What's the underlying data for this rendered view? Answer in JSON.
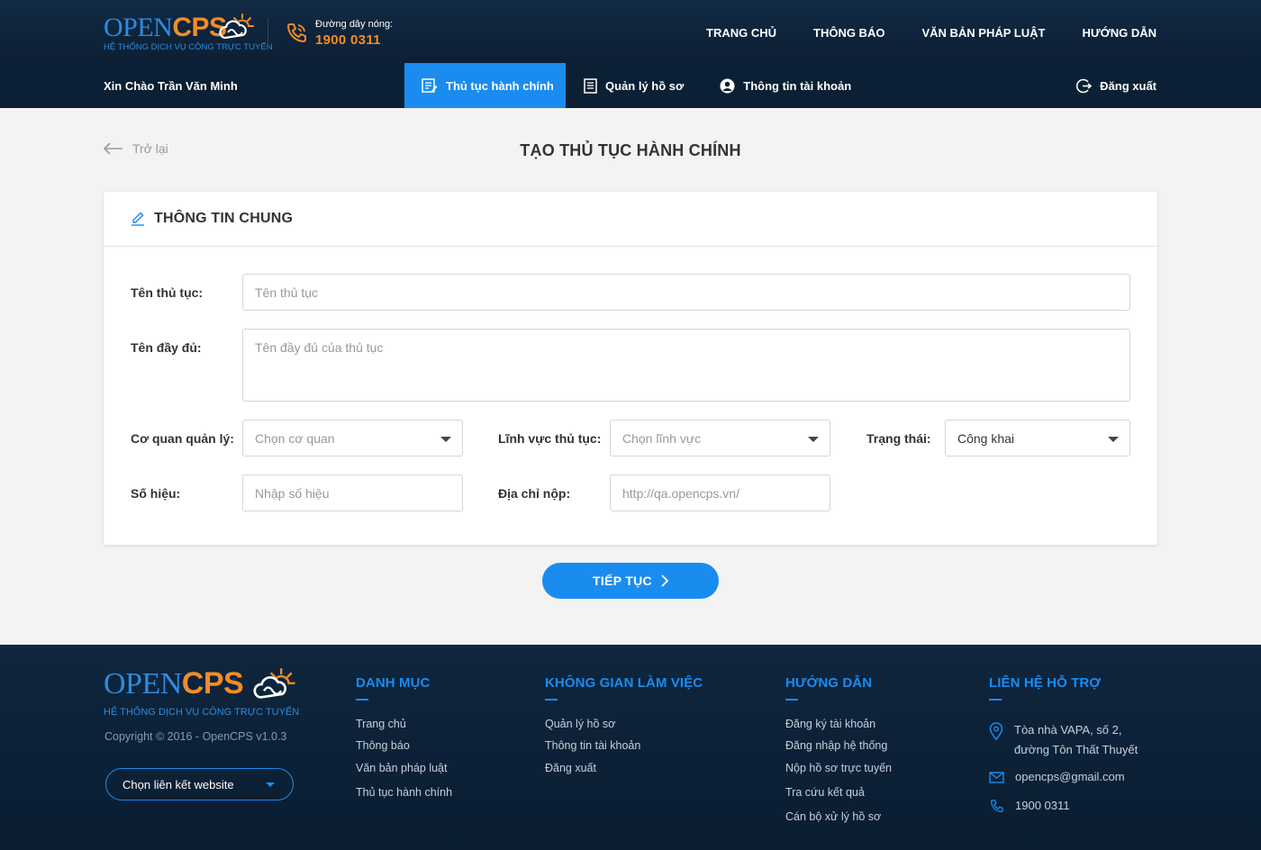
{
  "brand": {
    "logo_open": "OPEN",
    "logo_cps": "CPS",
    "tagline": "HỆ THỐNG DỊCH VỤ CÔNG TRỰC TUYẾN",
    "accent": "#1a8cf0",
    "orange": "#f28c28"
  },
  "header": {
    "hotline_label": "Đường dây nóng:",
    "hotline_number": "1900 0311",
    "nav": [
      "TRANG CHỦ",
      "THÔNG BÁO",
      "VĂN BẢN PHÁP LUẬT",
      "HƯỚNG DẪN"
    ]
  },
  "subnav": {
    "greeting": "Xin Chào Trần Văn Minh",
    "tabs": [
      {
        "label": "Thủ tục hành chính",
        "icon": "document-edit-icon",
        "active": true
      },
      {
        "label": "Quản lý hồ sơ",
        "icon": "document-list-icon",
        "active": false
      },
      {
        "label": "Thông tin tài khoản",
        "icon": "user-circle-icon",
        "active": false
      }
    ],
    "logout": "Đăng xuất"
  },
  "page": {
    "back": "Trở lại",
    "title": "TẠO THỦ TỤC HÀNH CHÍNH"
  },
  "form": {
    "section_title": "THÔNG TIN CHUNG",
    "name_label": "Tên thủ tục:",
    "name_placeholder": "Tên thủ tục",
    "fullname_label": "Tên đầy đủ:",
    "fullname_placeholder": "Tên đầy đủ của thủ tục",
    "agency_label": "Cơ quan quản lý:",
    "agency_value": "Chọn cơ quan",
    "field_label": "Lĩnh vực thủ tục:",
    "field_value": "Chọn lĩnh vực",
    "status_label": "Trạng thái:",
    "status_value": "Công khai",
    "code_label": "Số hiệu:",
    "code_placeholder": "Nhập số hiệu",
    "address_label": "Địa chỉ nộp:",
    "address_placeholder": "http://qa.opencps.vn/",
    "continue": "TIẾP TỤC"
  },
  "footer": {
    "copyright": "Copyright © 2016 - OpenCPS v1.0.3",
    "site_select": "Chọn liên kết website",
    "columns": [
      {
        "title": "DANH MỤC",
        "links": [
          "Trang chủ",
          "Thông báo",
          "Văn bản pháp luật",
          "Thủ tục hành chính"
        ]
      },
      {
        "title": "KHÔNG GIAN LÀM VIỆC",
        "links": [
          "Quản lý hồ sơ",
          "Thông tin tài khoản",
          "Đăng xuất"
        ]
      },
      {
        "title": "HƯỚNG DẪN",
        "links": [
          "Đăng ký tài khoản",
          "Đăng nhập hệ thống",
          "Nộp hồ sơ trực tuyến",
          "Tra cứu kết quả",
          "Cán bộ xử lý hồ sơ"
        ]
      }
    ],
    "contact": {
      "title": "LIÊN HỆ HỖ TRỢ",
      "address_line1": "Tòa nhà VAPA, số 2,",
      "address_line2": "đường Tôn Thất Thuyết",
      "email": "opencps@gmail.com",
      "phone": "1900 0311"
    }
  }
}
